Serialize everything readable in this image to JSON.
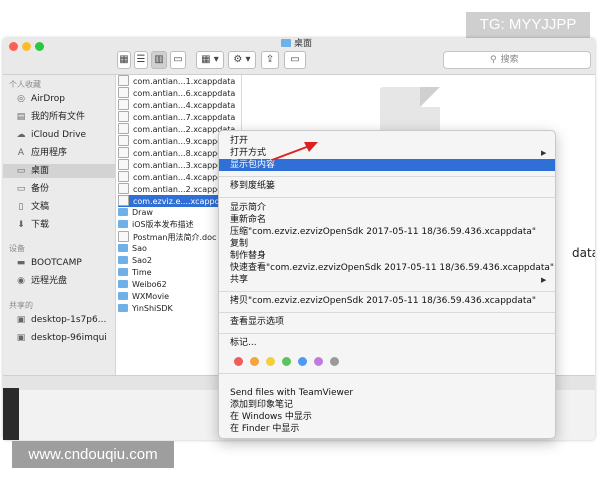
{
  "watermark": {
    "top_right": "TG: MYYJJPP",
    "bottom_left": "www.cndouqiu.com"
  },
  "window": {
    "title": "桌面",
    "search_placeholder": "搜索",
    "toolbar": {
      "back": "‹",
      "forward": "›",
      "action_glyph": "⚙"
    }
  },
  "sidebar": {
    "sections": [
      {
        "heading": "个人收藏",
        "items": [
          {
            "label": "AirDrop",
            "icon": "airdrop-icon",
            "glyph": "◎"
          },
          {
            "label": "我的所有文件",
            "icon": "all-files-icon",
            "glyph": "▤"
          },
          {
            "label": "iCloud Drive",
            "icon": "cloud-icon",
            "glyph": "☁"
          },
          {
            "label": "应用程序",
            "icon": "applications-icon",
            "glyph": "A"
          },
          {
            "label": "桌面",
            "icon": "desktop-icon",
            "glyph": "▭",
            "selected": true
          },
          {
            "label": "备份",
            "icon": "folder-icon",
            "glyph": "▭"
          },
          {
            "label": "文稿",
            "icon": "documents-icon",
            "glyph": "▯"
          },
          {
            "label": "下载",
            "icon": "downloads-icon",
            "glyph": "⬇"
          }
        ]
      },
      {
        "heading": "设备",
        "items": [
          {
            "label": "BOOTCAMP",
            "icon": "disk-icon",
            "glyph": "▬"
          },
          {
            "label": "远程光盘",
            "icon": "optical-disc-icon",
            "glyph": "◉"
          }
        ]
      },
      {
        "heading": "共享的",
        "items": [
          {
            "label": "desktop-1s7p6...",
            "icon": "network-computer-icon",
            "glyph": "▣"
          },
          {
            "label": "desktop-96imqui",
            "icon": "network-computer-icon",
            "glyph": "▣"
          }
        ]
      }
    ]
  },
  "files": [
    {
      "name": "com.antian...1.xcappdata",
      "type": "file"
    },
    {
      "name": "com.antian...6.xcappdata",
      "type": "file"
    },
    {
      "name": "com.antian...4.xcappdata",
      "type": "file"
    },
    {
      "name": "com.antian...7.xcappdata",
      "type": "file"
    },
    {
      "name": "com.antian...2.xcappdata",
      "type": "file"
    },
    {
      "name": "com.antian...9.xcappdata",
      "type": "file"
    },
    {
      "name": "com.antian...8.xcappdata",
      "type": "file"
    },
    {
      "name": "com.antian...3.xcappdata",
      "type": "file"
    },
    {
      "name": "com.antian...4.xcappdata",
      "type": "file"
    },
    {
      "name": "com.antian...2.xcappdata",
      "type": "file"
    },
    {
      "name": "com.ezviz.e....xcappdata",
      "type": "file",
      "selected": true
    },
    {
      "name": "Draw",
      "type": "folder"
    },
    {
      "name": "iOS版本发布描述",
      "type": "folder"
    },
    {
      "name": "Postman用法简介.doc",
      "type": "file"
    },
    {
      "name": "Sao",
      "type": "folder"
    },
    {
      "name": "Sao2",
      "type": "folder"
    },
    {
      "name": "Time",
      "type": "folder"
    },
    {
      "name": "Weibo62",
      "type": "folder"
    },
    {
      "name": "WXMovie",
      "type": "folder"
    },
    {
      "name": "YinShiSDK",
      "type": "folder"
    }
  ],
  "preview": {
    "partial_text": "data"
  },
  "context_menu": {
    "items": [
      {
        "label": "打开"
      },
      {
        "label": "打开方式",
        "submenu": true
      },
      {
        "label": "显示包内容",
        "highlighted": true
      },
      {
        "label": "移到废纸篓"
      },
      {
        "label": "显示简介"
      },
      {
        "label": "重新命名"
      },
      {
        "label": "压缩\"com.ezviz.ezvizOpenSdk 2017-05-11 18/36.59.436.xcappdata\""
      },
      {
        "label": "复制"
      },
      {
        "label": "制作替身"
      },
      {
        "label": "快速查看\"com.ezviz.ezvizOpenSdk 2017-05-11 18/36.59.436.xcappdata\""
      },
      {
        "label": "共享",
        "submenu": true
      },
      {
        "label": "拷贝\"com.ezviz.ezvizOpenSdk 2017-05-11 18/36.59.436.xcappdata\""
      },
      {
        "label": "查看显示选项"
      },
      {
        "label": "标记..."
      },
      {
        "label": "Send files with TeamViewer"
      },
      {
        "label": "添加到印象笔记"
      },
      {
        "label": "在 Windows 中显示"
      },
      {
        "label": "在 Finder 中显示"
      }
    ],
    "submenu_glyph": "▶",
    "tag_colors": [
      "#f25c5c",
      "#f5a33c",
      "#f2d03c",
      "#5cc45c",
      "#4a9cf0",
      "#c07be0",
      "#9a9a9a"
    ]
  },
  "annotation": {
    "arrow_color": "#e02020"
  },
  "colors": {
    "selection_blue": "#2f6fd6",
    "folder_blue": "#6fb1e6"
  }
}
